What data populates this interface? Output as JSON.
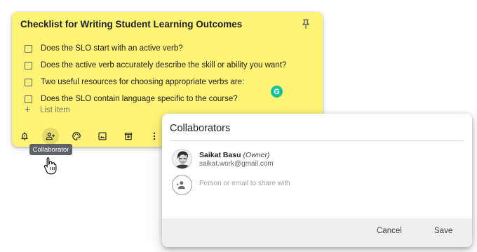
{
  "note": {
    "title": "Checklist for Writing Student Learning Outcomes",
    "items": [
      "Does the SLO start with an active verb?",
      "Does the active verb accurately describe the skill or ability you want?",
      "Two useful resources for choosing appropriate verbs are:",
      "Does the SLO contain language specific to the course?"
    ],
    "add_item_placeholder": "List item",
    "color": "#fff475",
    "toolbar_icons": [
      "remind-me-icon",
      "collaborator-icon",
      "palette-icon",
      "image-icon",
      "archive-icon",
      "more-icon"
    ]
  },
  "tooltip": {
    "text": "Collaborator"
  },
  "dialog": {
    "title": "Collaborators",
    "owner": {
      "name": "Saikat Basu",
      "role": "(Owner)",
      "email": "saikat.work@gmail.com"
    },
    "share_placeholder": "Person or email to share with",
    "cancel_label": "Cancel",
    "save_label": "Save"
  }
}
